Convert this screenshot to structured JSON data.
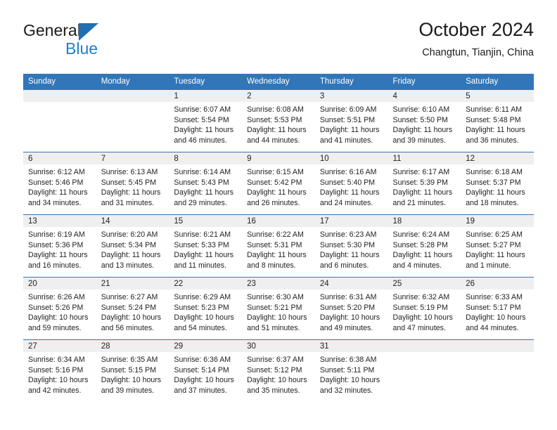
{
  "brand": {
    "name_top": "General",
    "name_bottom": "Blue",
    "triangle_color": "#1f6fb2",
    "blue_text_color": "#1f7fd0"
  },
  "header": {
    "title": "October 2024",
    "subtitle": "Changtun, Tianjin, China"
  },
  "theme": {
    "accent": "#3176b8",
    "daynum_band": "#efefef",
    "text": "#222222",
    "header_text": "#ffffff"
  },
  "calendar": {
    "weekday_headers": [
      "Sunday",
      "Monday",
      "Tuesday",
      "Wednesday",
      "Thursday",
      "Friday",
      "Saturday"
    ],
    "weeks": [
      [
        {
          "day": "",
          "sunrise": "",
          "sunset": "",
          "daylight": "",
          "empty": true
        },
        {
          "day": "",
          "sunrise": "",
          "sunset": "",
          "daylight": "",
          "empty": true
        },
        {
          "day": "1",
          "sunrise": "Sunrise: 6:07 AM",
          "sunset": "Sunset: 5:54 PM",
          "daylight": "Daylight: 11 hours and 46 minutes."
        },
        {
          "day": "2",
          "sunrise": "Sunrise: 6:08 AM",
          "sunset": "Sunset: 5:53 PM",
          "daylight": "Daylight: 11 hours and 44 minutes."
        },
        {
          "day": "3",
          "sunrise": "Sunrise: 6:09 AM",
          "sunset": "Sunset: 5:51 PM",
          "daylight": "Daylight: 11 hours and 41 minutes."
        },
        {
          "day": "4",
          "sunrise": "Sunrise: 6:10 AM",
          "sunset": "Sunset: 5:50 PM",
          "daylight": "Daylight: 11 hours and 39 minutes."
        },
        {
          "day": "5",
          "sunrise": "Sunrise: 6:11 AM",
          "sunset": "Sunset: 5:48 PM",
          "daylight": "Daylight: 11 hours and 36 minutes."
        }
      ],
      [
        {
          "day": "6",
          "sunrise": "Sunrise: 6:12 AM",
          "sunset": "Sunset: 5:46 PM",
          "daylight": "Daylight: 11 hours and 34 minutes."
        },
        {
          "day": "7",
          "sunrise": "Sunrise: 6:13 AM",
          "sunset": "Sunset: 5:45 PM",
          "daylight": "Daylight: 11 hours and 31 minutes."
        },
        {
          "day": "8",
          "sunrise": "Sunrise: 6:14 AM",
          "sunset": "Sunset: 5:43 PM",
          "daylight": "Daylight: 11 hours and 29 minutes."
        },
        {
          "day": "9",
          "sunrise": "Sunrise: 6:15 AM",
          "sunset": "Sunset: 5:42 PM",
          "daylight": "Daylight: 11 hours and 26 minutes."
        },
        {
          "day": "10",
          "sunrise": "Sunrise: 6:16 AM",
          "sunset": "Sunset: 5:40 PM",
          "daylight": "Daylight: 11 hours and 24 minutes."
        },
        {
          "day": "11",
          "sunrise": "Sunrise: 6:17 AM",
          "sunset": "Sunset: 5:39 PM",
          "daylight": "Daylight: 11 hours and 21 minutes."
        },
        {
          "day": "12",
          "sunrise": "Sunrise: 6:18 AM",
          "sunset": "Sunset: 5:37 PM",
          "daylight": "Daylight: 11 hours and 18 minutes."
        }
      ],
      [
        {
          "day": "13",
          "sunrise": "Sunrise: 6:19 AM",
          "sunset": "Sunset: 5:36 PM",
          "daylight": "Daylight: 11 hours and 16 minutes."
        },
        {
          "day": "14",
          "sunrise": "Sunrise: 6:20 AM",
          "sunset": "Sunset: 5:34 PM",
          "daylight": "Daylight: 11 hours and 13 minutes."
        },
        {
          "day": "15",
          "sunrise": "Sunrise: 6:21 AM",
          "sunset": "Sunset: 5:33 PM",
          "daylight": "Daylight: 11 hours and 11 minutes."
        },
        {
          "day": "16",
          "sunrise": "Sunrise: 6:22 AM",
          "sunset": "Sunset: 5:31 PM",
          "daylight": "Daylight: 11 hours and 8 minutes."
        },
        {
          "day": "17",
          "sunrise": "Sunrise: 6:23 AM",
          "sunset": "Sunset: 5:30 PM",
          "daylight": "Daylight: 11 hours and 6 minutes."
        },
        {
          "day": "18",
          "sunrise": "Sunrise: 6:24 AM",
          "sunset": "Sunset: 5:28 PM",
          "daylight": "Daylight: 11 hours and 4 minutes."
        },
        {
          "day": "19",
          "sunrise": "Sunrise: 6:25 AM",
          "sunset": "Sunset: 5:27 PM",
          "daylight": "Daylight: 11 hours and 1 minute."
        }
      ],
      [
        {
          "day": "20",
          "sunrise": "Sunrise: 6:26 AM",
          "sunset": "Sunset: 5:26 PM",
          "daylight": "Daylight: 10 hours and 59 minutes."
        },
        {
          "day": "21",
          "sunrise": "Sunrise: 6:27 AM",
          "sunset": "Sunset: 5:24 PM",
          "daylight": "Daylight: 10 hours and 56 minutes."
        },
        {
          "day": "22",
          "sunrise": "Sunrise: 6:29 AM",
          "sunset": "Sunset: 5:23 PM",
          "daylight": "Daylight: 10 hours and 54 minutes."
        },
        {
          "day": "23",
          "sunrise": "Sunrise: 6:30 AM",
          "sunset": "Sunset: 5:21 PM",
          "daylight": "Daylight: 10 hours and 51 minutes."
        },
        {
          "day": "24",
          "sunrise": "Sunrise: 6:31 AM",
          "sunset": "Sunset: 5:20 PM",
          "daylight": "Daylight: 10 hours and 49 minutes."
        },
        {
          "day": "25",
          "sunrise": "Sunrise: 6:32 AM",
          "sunset": "Sunset: 5:19 PM",
          "daylight": "Daylight: 10 hours and 47 minutes."
        },
        {
          "day": "26",
          "sunrise": "Sunrise: 6:33 AM",
          "sunset": "Sunset: 5:17 PM",
          "daylight": "Daylight: 10 hours and 44 minutes."
        }
      ],
      [
        {
          "day": "27",
          "sunrise": "Sunrise: 6:34 AM",
          "sunset": "Sunset: 5:16 PM",
          "daylight": "Daylight: 10 hours and 42 minutes."
        },
        {
          "day": "28",
          "sunrise": "Sunrise: 6:35 AM",
          "sunset": "Sunset: 5:15 PM",
          "daylight": "Daylight: 10 hours and 39 minutes."
        },
        {
          "day": "29",
          "sunrise": "Sunrise: 6:36 AM",
          "sunset": "Sunset: 5:14 PM",
          "daylight": "Daylight: 10 hours and 37 minutes."
        },
        {
          "day": "30",
          "sunrise": "Sunrise: 6:37 AM",
          "sunset": "Sunset: 5:12 PM",
          "daylight": "Daylight: 10 hours and 35 minutes."
        },
        {
          "day": "31",
          "sunrise": "Sunrise: 6:38 AM",
          "sunset": "Sunset: 5:11 PM",
          "daylight": "Daylight: 10 hours and 32 minutes."
        },
        {
          "day": "",
          "sunrise": "",
          "sunset": "",
          "daylight": "",
          "empty": true
        },
        {
          "day": "",
          "sunrise": "",
          "sunset": "",
          "daylight": "",
          "empty": true
        }
      ]
    ]
  }
}
